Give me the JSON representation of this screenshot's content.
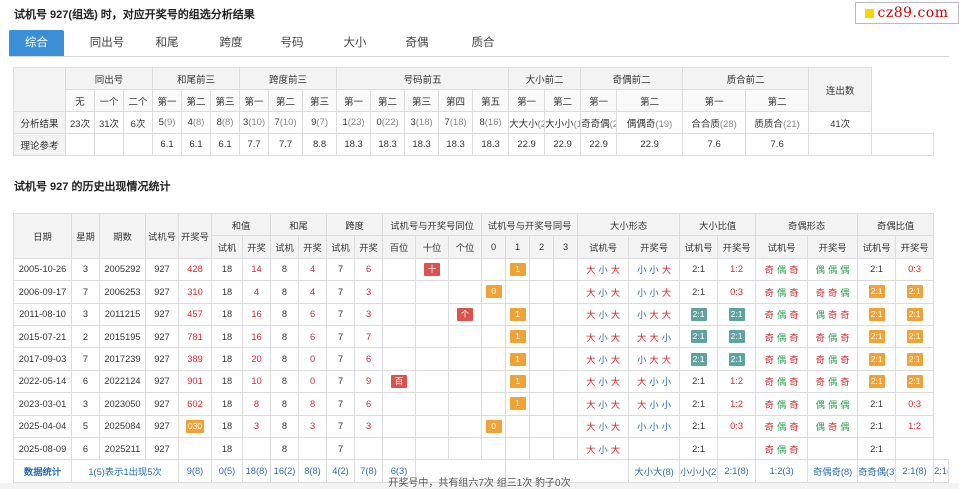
{
  "page_title": "试机号 927(组选) 时，对应开奖号的组选分析结果",
  "logo": {
    "text": "cz89.com",
    "mark": "yellow-square-icon"
  },
  "tabs": [
    "综合",
    "同出号",
    "和尾",
    "跨度",
    "号码",
    "大小",
    "奇偶",
    "质合"
  ],
  "active_tab": 0,
  "summary": {
    "groups": [
      "同出号",
      "和尾前三",
      "跨度前三",
      "号码前五",
      "大小前二",
      "奇偶前二",
      "质合前二"
    ],
    "last_col": "连出数",
    "subheads": [
      "无",
      "一个",
      "二个",
      "第一",
      "第二",
      "第三",
      "第一",
      "第二",
      "第三",
      "第一",
      "第二",
      "第三",
      "第四",
      "第五",
      "第一",
      "第二",
      "第一",
      "第二",
      "第一",
      "第二"
    ],
    "rows": [
      {
        "label": "分析结果",
        "cells": [
          [
            "23次",
            ""
          ],
          [
            "31次",
            ""
          ],
          [
            "6次",
            ""
          ],
          [
            "5",
            "(9)"
          ],
          [
            "4",
            "(8)"
          ],
          [
            "8",
            "(8)"
          ],
          [
            "3",
            "(10)"
          ],
          [
            "7",
            "(10)"
          ],
          [
            "9",
            "(7)"
          ],
          [
            "1",
            "(23)"
          ],
          [
            "0",
            "(22)"
          ],
          [
            "3",
            "(18)"
          ],
          [
            "7",
            "(18)"
          ],
          [
            "8",
            "(16)"
          ],
          [
            "大大小",
            "(27)"
          ],
          [
            "大小小",
            "(16)"
          ],
          [
            "奇奇偶",
            "(28)"
          ],
          [
            "偶偶奇",
            "(19)"
          ],
          [
            "合合质",
            "(28)"
          ],
          [
            "质质合",
            "(21)"
          ],
          [
            "41次",
            ""
          ]
        ]
      },
      {
        "label": "理论参考",
        "cells": [
          [
            "",
            ""
          ],
          [
            "",
            ""
          ],
          [
            "",
            ""
          ],
          [
            "6.1",
            ""
          ],
          [
            "6.1",
            ""
          ],
          [
            "6.1",
            ""
          ],
          [
            "7.7",
            ""
          ],
          [
            "7.7",
            ""
          ],
          [
            "8.8",
            ""
          ],
          [
            "18.3",
            ""
          ],
          [
            "18.3",
            ""
          ],
          [
            "18.3",
            ""
          ],
          [
            "18.3",
            ""
          ],
          [
            "18.3",
            ""
          ],
          [
            "22.9",
            ""
          ],
          [
            "22.9",
            ""
          ],
          [
            "22.9",
            ""
          ],
          [
            "22.9",
            ""
          ],
          [
            "7.6",
            ""
          ],
          [
            "7.6",
            ""
          ],
          [
            "",
            ""
          ]
        ]
      }
    ]
  },
  "history": {
    "title": "试机号 927 的历史出现情况统计",
    "head1": [
      "日期",
      "星期",
      "期数",
      "试机号",
      "开奖号",
      "和值",
      "和尾",
      "跨度",
      "试机号与开奖号同位",
      "试机号与开奖号同号",
      "大小形态",
      "大小比值",
      "奇偶形态",
      "奇偶比值"
    ],
    "head2": [
      "试机",
      "开奖",
      "试机",
      "开奖",
      "试机",
      "开奖",
      "百位",
      "十位",
      "个位",
      "0",
      "1",
      "2",
      "3",
      "试机号",
      "开奖号",
      "试机号",
      "开奖号",
      "试机号",
      "开奖号",
      "试机号",
      "开奖号"
    ],
    "rows": [
      [
        "2005-10-26",
        "3",
        "2005292",
        "927",
        "428",
        "18",
        "14",
        "8",
        "4",
        "7",
        "6",
        "",
        "十",
        "",
        "",
        "1",
        "",
        "",
        "大小大",
        "小小大",
        "2:1",
        "1:2",
        "奇偶奇",
        "偶偶偶",
        "2:1",
        "0:3"
      ],
      [
        "2006-09-17",
        "7",
        "2006253",
        "927",
        "310",
        "18",
        "4",
        "8",
        "4",
        "7",
        "3",
        "",
        "",
        "",
        "0",
        "",
        "",
        "",
        "大小大",
        "小小大",
        "2:1",
        "0:3",
        "奇偶奇",
        "奇奇偶",
        "2:1",
        "2:1"
      ],
      [
        "2011-08-10",
        "3",
        "2011215",
        "927",
        "457",
        "18",
        "16",
        "8",
        "6",
        "7",
        "3",
        "",
        "",
        "个",
        "",
        "1",
        "",
        "",
        "大小大",
        "小大大",
        "2:1",
        "2:1",
        "奇偶奇",
        "偶奇奇",
        "2:1",
        "2:1"
      ],
      [
        "2015-07-21",
        "2",
        "2015195",
        "927",
        "781",
        "18",
        "16",
        "8",
        "6",
        "7",
        "7",
        "",
        "",
        "",
        "",
        "1",
        "",
        "",
        "大小大",
        "大大小",
        "2:1",
        "2:1",
        "奇偶奇",
        "奇偶奇",
        "2:1",
        "2:1"
      ],
      [
        "2017-09-03",
        "7",
        "2017239",
        "927",
        "389",
        "18",
        "20",
        "8",
        "0",
        "7",
        "6",
        "",
        "",
        "",
        "",
        "1",
        "",
        "",
        "大小大",
        "小大大",
        "2:1",
        "2:1",
        "奇偶奇",
        "奇偶奇",
        "2:1",
        "2:1"
      ],
      [
        "2022-05-14",
        "6",
        "2022124",
        "927",
        "901",
        "18",
        "10",
        "8",
        "0",
        "7",
        "9",
        "百",
        "",
        "",
        "",
        "1",
        "",
        "",
        "大小大",
        "大小小",
        "2:1",
        "1:2",
        "奇偶奇",
        "奇偶奇",
        "2:1",
        "2:1"
      ],
      [
        "2023-03-01",
        "3",
        "2023050",
        "927",
        "602",
        "18",
        "8",
        "8",
        "8",
        "7",
        "6",
        "",
        "",
        "",
        "",
        "1",
        "",
        "",
        "大小大",
        "大小小",
        "2:1",
        "1:2",
        "奇偶奇",
        "偶偶偶",
        "2:1",
        "0:3"
      ],
      [
        "2025-04-04",
        "5",
        "2025084",
        "927",
        "030",
        "18",
        "3",
        "8",
        "3",
        "7",
        "3",
        "",
        "",
        "",
        "0",
        "",
        "",
        "",
        "大小大",
        "小小小",
        "2:1",
        "0:3",
        "奇偶奇",
        "偶奇偶",
        "2:1",
        "1:2"
      ],
      [
        "2025-08-09",
        "6",
        "2025211",
        "927",
        "",
        "18",
        "",
        "8",
        "",
        "7",
        "",
        "",
        "",
        "",
        "",
        "",
        "",
        "",
        "大小大",
        "",
        "2:1",
        "",
        "奇偶奇",
        "",
        "2:1",
        ""
      ]
    ],
    "stat_row": [
      "数据统计",
      "1(5)表示1出现5次",
      "9(8)",
      "0(5)",
      "18(8)",
      "16(2)",
      "8(8)",
      "4(2)",
      "7(8)",
      "6(3)",
      "",
      "",
      "",
      "",
      "",
      "",
      "",
      "大小大(8)",
      "小小小(2)",
      "2:1(8)",
      "1:2(3)",
      "奇偶奇(8)",
      "奇奇偶(3)",
      "2:1(8)",
      "2:1(5)"
    ]
  },
  "footer_note": "开奖号中，共有组六7次 组三1次 豹子0次"
}
